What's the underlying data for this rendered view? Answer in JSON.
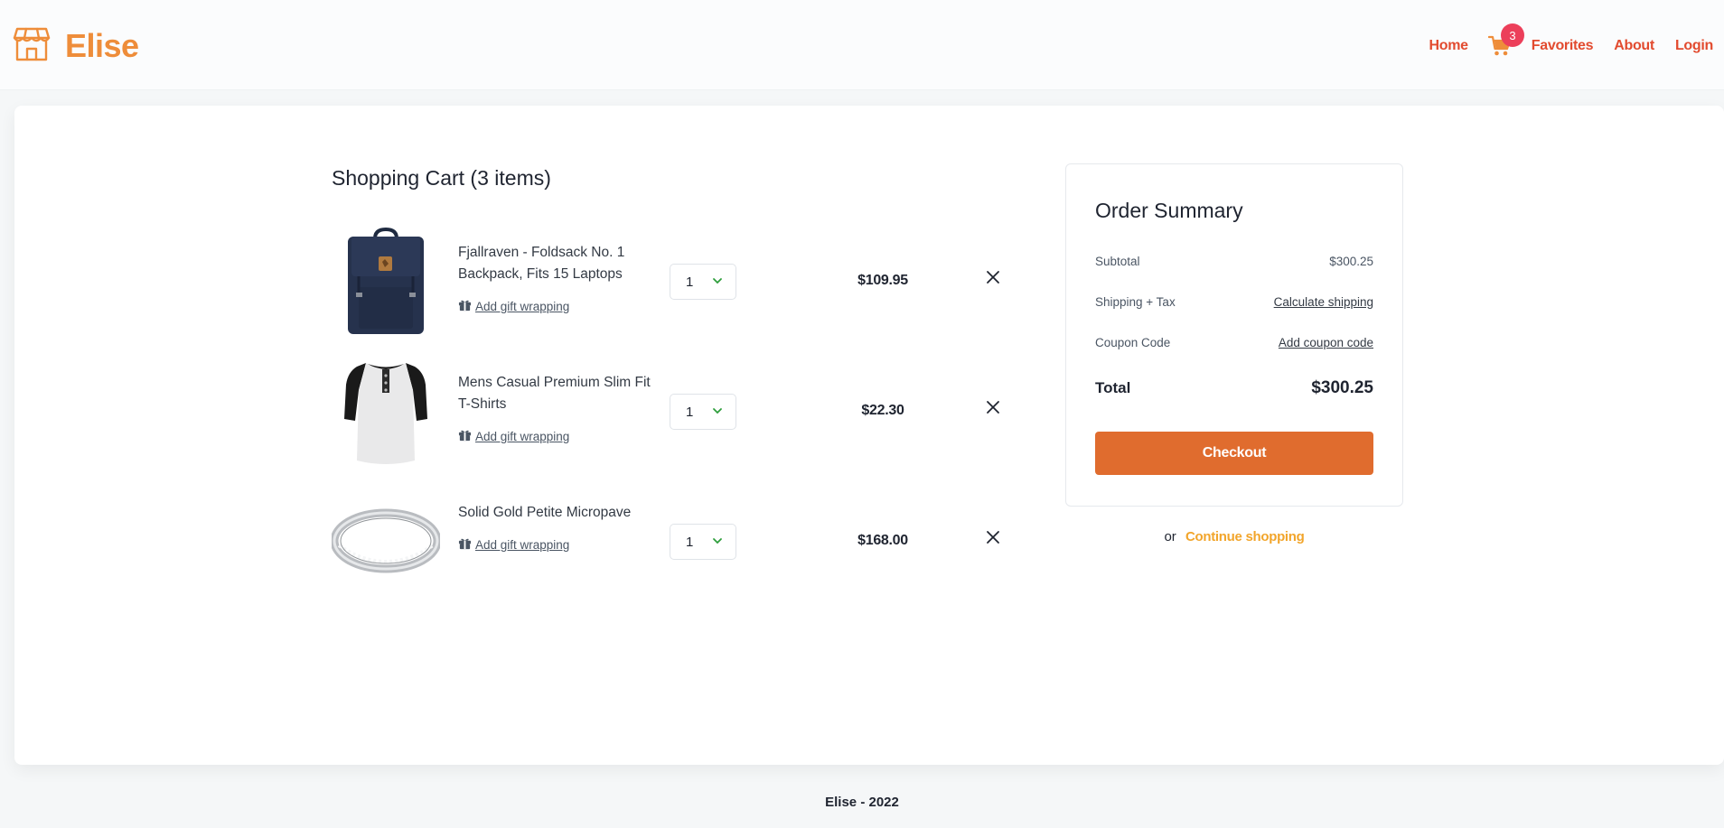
{
  "brand": {
    "name": "Elise",
    "logo_icon": "storefront-icon"
  },
  "nav": {
    "home": "Home",
    "cart_count": "3",
    "favorites": "Favorites",
    "about": "About",
    "login": "Login"
  },
  "cart": {
    "title": "Shopping Cart (3 items)",
    "gift_label": "Add gift wrapping",
    "items": [
      {
        "name": "Fjallraven - Foldsack No. 1 Backpack, Fits 15 Laptops",
        "qty": "1",
        "price": "$109.95",
        "image": "backpack"
      },
      {
        "name": "Mens Casual Premium Slim Fit T-Shirts",
        "qty": "1",
        "price": "$22.30",
        "image": "tshirt"
      },
      {
        "name": "Solid Gold Petite Micropave",
        "qty": "1",
        "price": "$168.00",
        "image": "ring"
      }
    ]
  },
  "summary": {
    "title": "Order Summary",
    "subtotal_label": "Subtotal",
    "subtotal_value": "$300.25",
    "shipping_label": "Shipping + Tax",
    "shipping_link": "Calculate shipping",
    "coupon_label": "Coupon Code",
    "coupon_link": "Add coupon code",
    "total_label": "Total",
    "total_value": "$300.25",
    "checkout_label": "Checkout",
    "or_text": "or",
    "continue_label": "Continue shopping"
  },
  "footer": {
    "text": "Elise - 2022"
  },
  "colors": {
    "brand": "#ee8d3a",
    "nav_link": "#e24b2f",
    "badge": "#ec3f5a",
    "checkout": "#e06c2e",
    "continue": "#f2a52b",
    "qty_chevron": "#2e9e3c"
  }
}
